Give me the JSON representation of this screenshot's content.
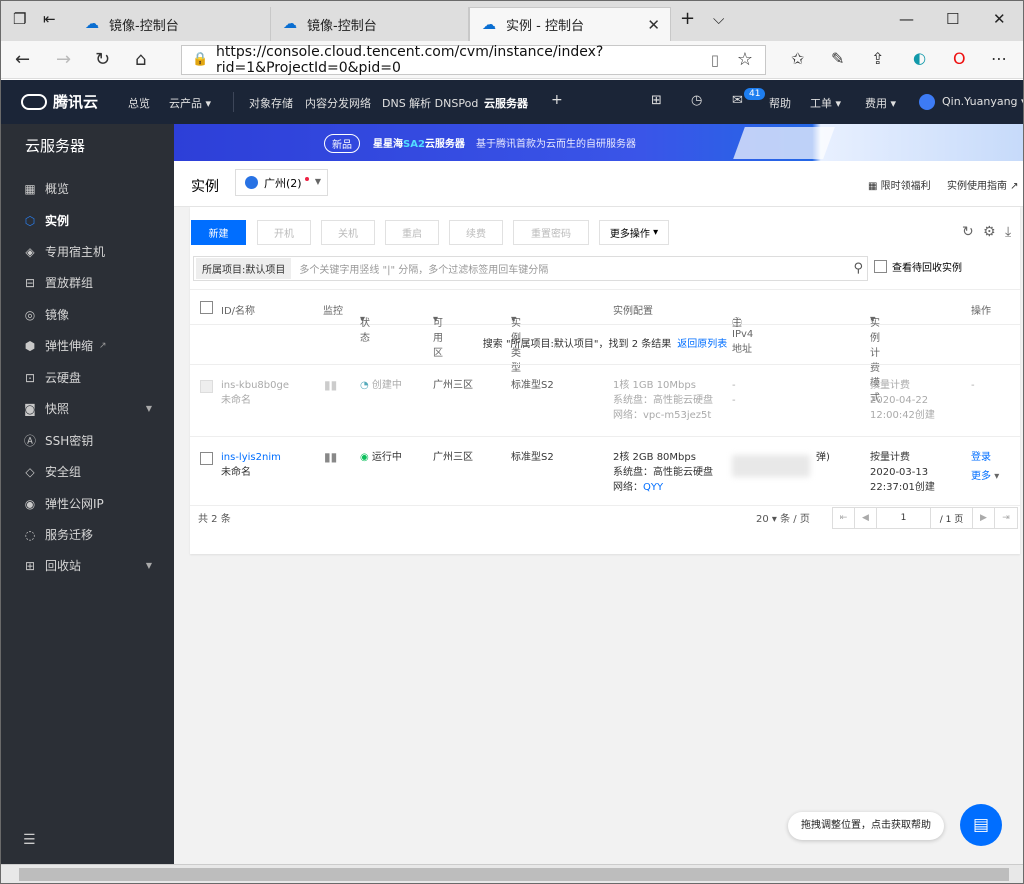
{
  "browser": {
    "tabs": [
      {
        "label": "镜像-控制台"
      },
      {
        "label": "镜像-控制台"
      },
      {
        "label": "实例 - 控制台"
      }
    ],
    "url": "https://console.cloud.tencent.com/cvm/instance/index?rid=1&ProjectId=0&pid=0"
  },
  "topnav": {
    "brand": "腾讯云",
    "items": [
      "总览",
      "云产品",
      "对象存储",
      "内容分发网络",
      "DNS 解析 DNSPod",
      "云服务器"
    ],
    "badge": "41",
    "help": "帮助",
    "ticket": "工单",
    "fee": "费用",
    "user": "Qin.Yuanyang"
  },
  "sidebar": {
    "title": "云服务器",
    "items": [
      {
        "label": "概览",
        "icon": "grid-icon"
      },
      {
        "label": "实例",
        "icon": "cube-icon"
      },
      {
        "label": "专用宿主机",
        "icon": "layers-icon"
      },
      {
        "label": "置放群组",
        "icon": "group-icon"
      },
      {
        "label": "镜像",
        "icon": "disc-icon"
      },
      {
        "label": "弹性伸缩",
        "icon": "scale-icon"
      },
      {
        "label": "云硬盘",
        "icon": "disk-icon"
      },
      {
        "label": "快照",
        "icon": "camera-icon"
      },
      {
        "label": "SSH密钥",
        "icon": "key-icon"
      },
      {
        "label": "安全组",
        "icon": "shield-icon"
      },
      {
        "label": "弹性公网IP",
        "icon": "ip-icon"
      },
      {
        "label": "服务迁移",
        "icon": "migrate-icon"
      },
      {
        "label": "回收站",
        "icon": "trash-icon"
      }
    ]
  },
  "banner": {
    "pill": "新品",
    "title_a": "星星海",
    "title_b": "SA2",
    "title_c": "云服务器",
    "desc": "基于腾讯首款为云而生的自研服务器"
  },
  "header": {
    "title": "实例",
    "region": "广州(2)",
    "limited": "限时领福利",
    "guide": "实例使用指南"
  },
  "toolbar": {
    "new": "新建",
    "start": "开机",
    "stop": "关机",
    "restart": "重启",
    "renew": "续费",
    "reset_pwd": "重置密码",
    "more": "更多操作"
  },
  "search": {
    "tag": "所属项目:默认项目",
    "placeholder": "多个关键字用竖线 \"|\" 分隔，多个过滤标签用回车键分隔",
    "recycle": "查看待回收实例"
  },
  "table": {
    "headers": [
      "ID/名称",
      "监控",
      "状态",
      "可用区",
      "实例类型",
      "实例配置",
      "主IPv4地址",
      "实例计费模式",
      "操作"
    ],
    "notice_a": "搜索 \"所属项目:默认项目\"，找到 2 条结果",
    "notice_link": "返回原列表",
    "rows": [
      {
        "id": "ins-kbu8b0ge",
        "name": "未命名",
        "status": "创建中",
        "zone": "广州三区",
        "type": "标准型S2",
        "cfg1": "1核 1GB 10Mbps",
        "cfg2": "系统盘：高性能云硬盘",
        "cfg3": "网络：vpc-m53jez5t",
        "ip1": "-",
        "ip2": "-",
        "bill1": "按量计费",
        "bill2": "2020-04-22",
        "bill3": "12:00:42创建",
        "op": "-"
      },
      {
        "id": "ins-lyis2nim",
        "name": "未命名",
        "status": "运行中",
        "zone": "广州三区",
        "type": "标准型S2",
        "cfg1": "2核 2GB 80Mbps",
        "cfg2": "系统盘：高性能云硬盘",
        "cfg3_label": "网络：",
        "cfg3_link": "QYY",
        "ip_tail": "弹)",
        "bill1": "按量计费",
        "bill2": "2020-03-13",
        "bill3": "22:37:01创建",
        "op1": "登录",
        "op2": "更多"
      }
    ]
  },
  "footer": {
    "total": "共 2 条",
    "page_size": "20",
    "per_page": "条 / 页",
    "page": "1",
    "pages": "/ 1 页"
  },
  "help": {
    "tip": "拖拽调整位置，点击获取帮助"
  }
}
